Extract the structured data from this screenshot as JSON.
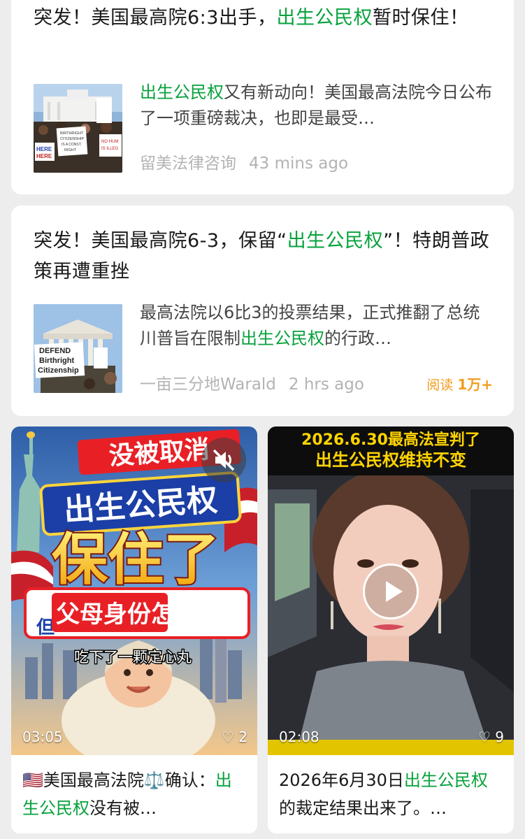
{
  "article1": {
    "title_a": "突发！美国最高院6:3出手，",
    "title_hl": "出生公民权",
    "title_b": "暂时保住！",
    "summary_hl": "出生公民权",
    "summary_b": "又有新动向！美国最高法院今日公布了一项重磅裁决，也即是最受…",
    "source": "留美法律咨询",
    "time": "43 mins ago",
    "thumb_signs": [
      "BIRTHRIGHT CITIZENSHIP IS A CONSTITUTIONAL RIGHT",
      "HERE",
      "DEFEND BIRTHRIGHT CITIZENSHIP",
      "NO HUMAN IS ILLEGAL"
    ]
  },
  "article2": {
    "title_a": "突发！美国最高院6-3，保留“",
    "title_hl": "出生公民权",
    "title_b": "”！特朗普政策再遭重挫",
    "summary_a": "最高法院以6比3的投票结果，正式推翻了总统川普旨在限制",
    "summary_hl": "出生公民权",
    "summary_b": "的行政…",
    "source": "一亩三分地Warald",
    "time": "2 hrs ago",
    "reads_label": "阅读",
    "reads_count": "1万+",
    "thumb_sign": "DEFEND Birthright Citizenship"
  },
  "video1": {
    "banner_top": "没被取消",
    "banner_main": "出生公民权",
    "banner_big": "保住了",
    "banner_dan": "但",
    "banner_q": "父母身份怎么办?",
    "subtitle": "吃下了一颗定心丸",
    "duration": "03:05",
    "likes": "2",
    "caption_a": "🇺🇸美国最高法院⚖️确认：",
    "caption_hl": "出生公民权",
    "caption_b": "没有被…"
  },
  "video2": {
    "banner_line1": "2026.6.30最高法宣判了",
    "banner_line2": "出生公民权维持不变",
    "duration": "02:08",
    "likes": "9",
    "caption_a": "2026年6月30日",
    "caption_hl": "出生公民权",
    "caption_b": "的裁定结果出来了。…"
  },
  "colors": {
    "highlight": "#07a23c",
    "reads": "#f29c1f",
    "background": "#ededed"
  },
  "icons": [
    "mute-icon",
    "play-icon",
    "heart-icon"
  ]
}
